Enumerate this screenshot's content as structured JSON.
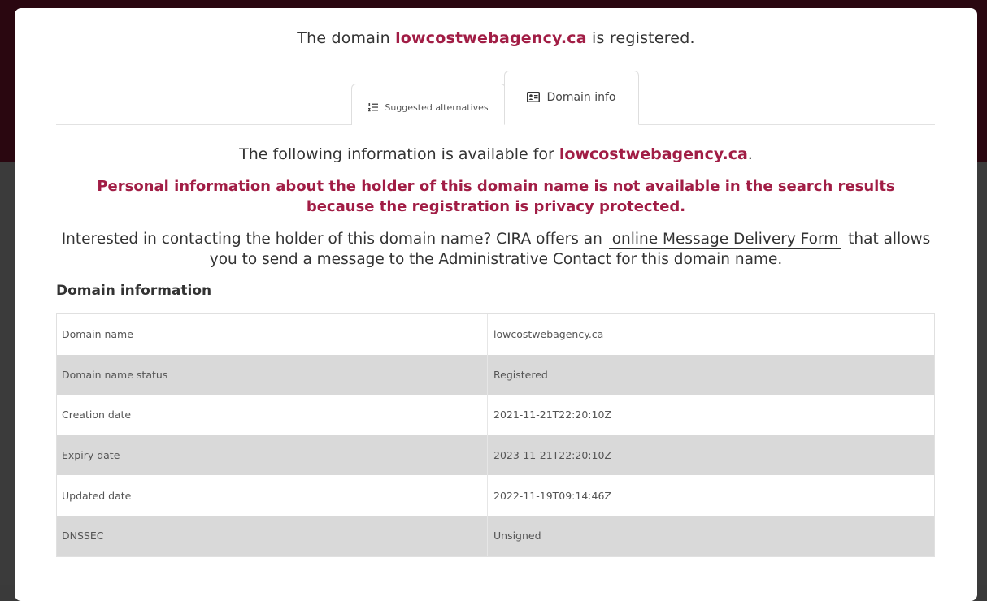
{
  "headline": {
    "prefix": "The domain ",
    "domain": "lowcostwebagency.ca",
    "suffix": " is registered."
  },
  "tabs": {
    "alternatives": {
      "label": "Suggested alternatives",
      "icon": "list-numbered-icon"
    },
    "domain_info": {
      "label": "Domain info",
      "icon": "id-card-icon"
    }
  },
  "availability": {
    "prefix": "The following information is available for ",
    "domain": "lowcostwebagency.ca",
    "suffix": "."
  },
  "privacy_notice": "Personal information about the holder of this domain name is not available in the search results because the registration is privacy protected.",
  "contact": {
    "prefix": "Interested in contacting the holder of this domain name? CIRA offers an ",
    "link": "online Message Delivery Form",
    "suffix": " that allows you to send a message to the Administrative Contact for this domain name."
  },
  "section_title": "Domain information",
  "domain_table": [
    {
      "key": "Domain name",
      "value": "lowcostwebagency.ca"
    },
    {
      "key": "Domain name status",
      "value": "Registered"
    },
    {
      "key": "Creation date",
      "value": "2021-11-21T22:20:10Z"
    },
    {
      "key": "Expiry date",
      "value": "2023-11-21T22:20:10Z"
    },
    {
      "key": "Updated date",
      "value": "2022-11-19T09:14:46Z"
    },
    {
      "key": "DNSSEC",
      "value": "Unsigned"
    }
  ],
  "colors": {
    "accent": "#a11d45",
    "backdrop_top": "#2a0710",
    "backdrop_bottom": "#3b3b3b",
    "row_shade": "#d9d9d9"
  }
}
